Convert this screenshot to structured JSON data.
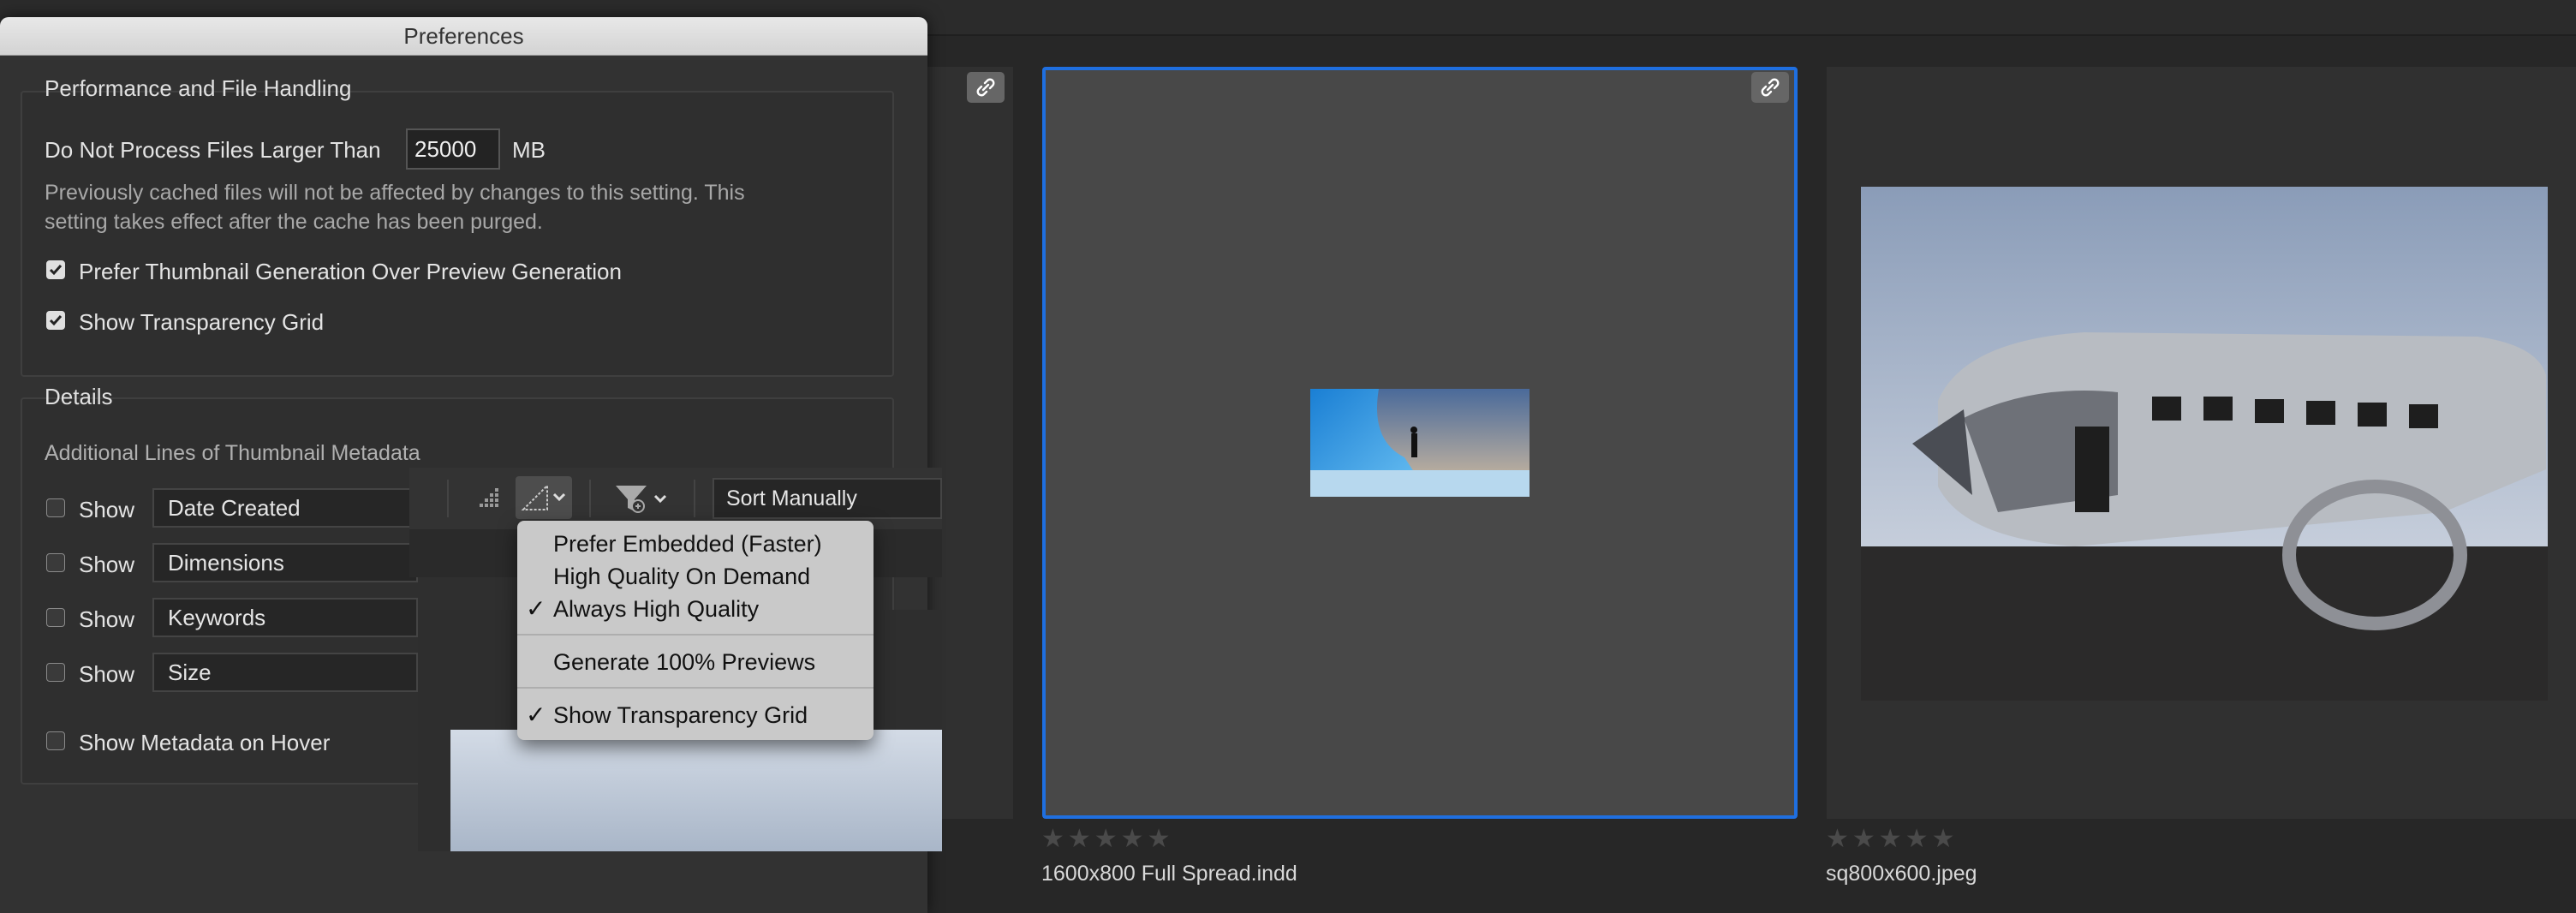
{
  "dialog": {
    "title": "Preferences",
    "performance": {
      "heading": "Performance and File Handling",
      "limit_label": "Do Not Process Files Larger Than",
      "limit_value": "25000",
      "limit_unit": "MB",
      "note_line1": "Previously cached files will not be affected by changes to this setting. This",
      "note_line2": "setting takes effect after the cache has been purged.",
      "prefer_thumbnail_label": "Prefer Thumbnail Generation Over Preview Generation",
      "prefer_thumbnail_checked": true,
      "transparency_grid_label": "Show Transparency Grid",
      "transparency_grid_checked": true
    },
    "details": {
      "heading": "Details",
      "metadata_lines_label": "Additional Lines of Thumbnail Metadata",
      "rows": [
        {
          "show_label": "Show",
          "value": "Date Created",
          "checked": false
        },
        {
          "show_label": "Show",
          "value": "Dimensions",
          "checked": false
        },
        {
          "show_label": "Show",
          "value": "Keywords",
          "checked": false
        },
        {
          "show_label": "Show",
          "value": "Size",
          "checked": false
        }
      ],
      "hover_label": "Show Metadata on Hover",
      "hover_checked": false
    }
  },
  "toolbar": {
    "sort_value": "Sort Manually",
    "icons": [
      "quality-low-icon",
      "quality-high-icon",
      "filter-icon"
    ]
  },
  "quality_menu": {
    "items": [
      {
        "label": "Prefer Embedded (Faster)",
        "checked": false
      },
      {
        "label": "High Quality On Demand",
        "checked": false
      },
      {
        "label": "Always High Quality",
        "checked": true
      },
      {
        "label": "Generate 100% Previews",
        "checked": false
      },
      {
        "label": "Show Transparency Grid",
        "checked": true
      }
    ],
    "check_glyph": "✓"
  },
  "browser": {
    "items": [
      {
        "filename": "1600x800 Full Spread.indd",
        "rating": "★★★★★",
        "selected": true
      },
      {
        "filename": "sq800x600.jpeg",
        "rating": "★★★★★",
        "selected": false
      }
    ]
  },
  "colors": {
    "selection": "#1f6fe0",
    "dialog_bg": "#323232",
    "menu_bg": "#c9c9c9"
  }
}
